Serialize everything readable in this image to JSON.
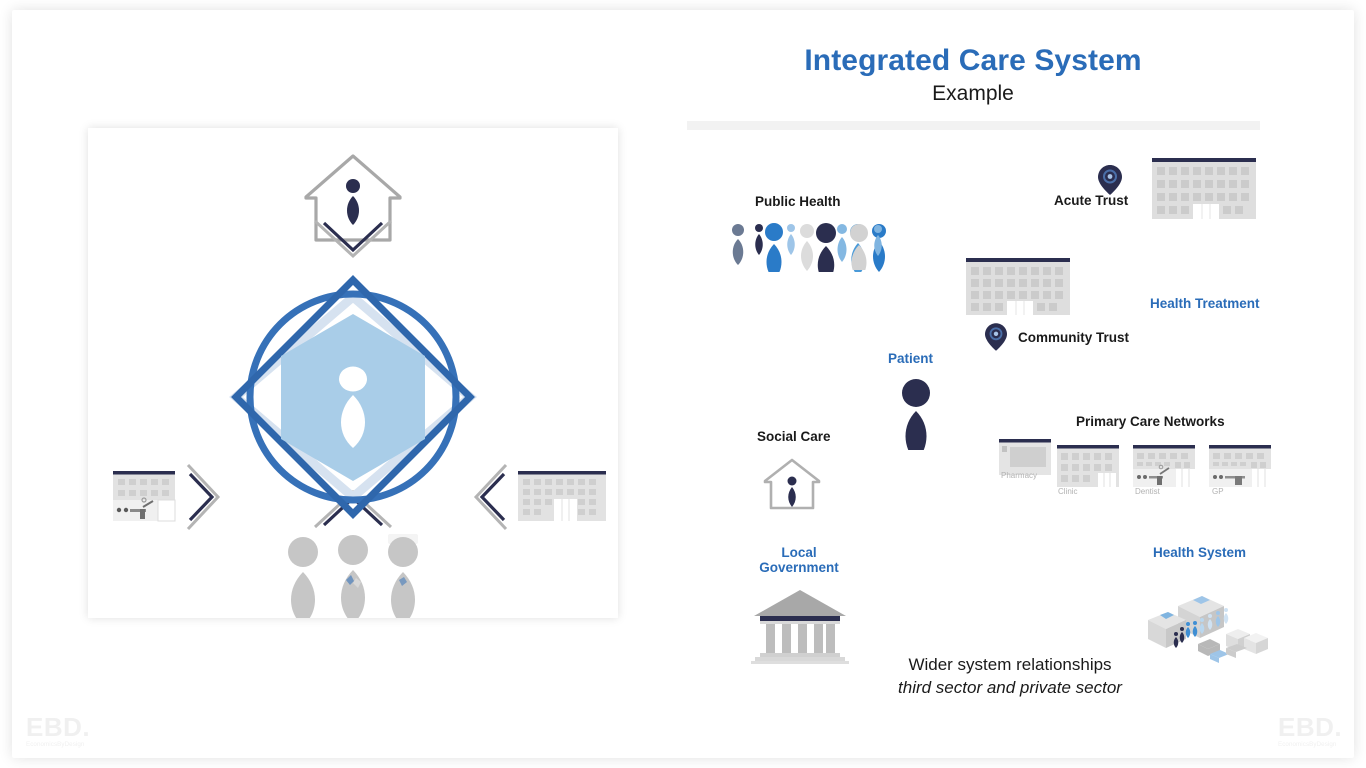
{
  "header": {
    "title": "Integrated Care System",
    "subtitle": "Example"
  },
  "left_panel": {
    "name": "integrated-care-wheel",
    "center_icon": "person-hexagon-icon",
    "top_icon": "home-person-icon",
    "bottom_icon": "people-group-icon",
    "left_icon": "clinic-building-icon",
    "right_icon": "hospital-building-icon"
  },
  "right_panel": {
    "labels": [
      {
        "id": "public-health",
        "text": "Public Health",
        "color": "#1a1a1a"
      },
      {
        "id": "acute-trust",
        "text": "Acute Trust",
        "color": "#1a1a1a"
      },
      {
        "id": "health-treatment",
        "text": "Health Treatment",
        "color": "#2a6cb8"
      },
      {
        "id": "community-trust",
        "text": "Community Trust",
        "color": "#1a1a1a"
      },
      {
        "id": "patient",
        "text": "Patient",
        "color": "#2a6cb8"
      },
      {
        "id": "social-care",
        "text": "Social Care",
        "color": "#1a1a1a"
      },
      {
        "id": "primary-care-networks",
        "text": "Primary Care Networks",
        "color": "#1a1a1a"
      },
      {
        "id": "local-government",
        "text": "Local\nGovernment",
        "color": "#2a6cb8"
      },
      {
        "id": "health-system",
        "text": "Health System",
        "color": "#2a6cb8"
      }
    ],
    "local_government_line1": "Local",
    "local_government_line2": "Government",
    "primary_care_items": [
      {
        "label": "Pharmacy"
      },
      {
        "label": "Clinic"
      },
      {
        "label": "Dentist"
      },
      {
        "label": "GP"
      }
    ],
    "footnote_line1": "Wider system relationships",
    "footnote_line2": "third sector and private sector"
  },
  "branding": {
    "logo_text": "EBD.",
    "logo_tagline": "EconomicsByDesign"
  },
  "colors": {
    "accent_blue": "#2a6cb8",
    "navy": "#2b2e4f",
    "light_blue": "#a9cde8",
    "mid_blue": "#4a90d0",
    "grey": "#c8c8c8",
    "light_grey": "#dcdcdc",
    "slate": "#6b7a93",
    "text_dark": "#1a1a1a",
    "panel_rule": "#f2f2f2"
  }
}
